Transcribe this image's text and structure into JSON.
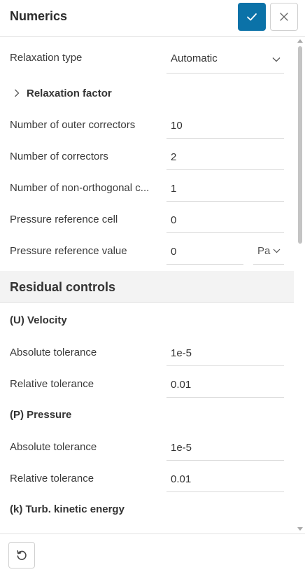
{
  "header": {
    "title": "Numerics",
    "confirm_icon": "check-icon",
    "close_icon": "close-icon"
  },
  "settings": {
    "relaxation_type": {
      "label": "Relaxation type",
      "value": "Automatic"
    },
    "relaxation_factor": {
      "label": "Relaxation factor"
    },
    "outer_correctors": {
      "label": "Number of outer correctors",
      "value": "10"
    },
    "correctors": {
      "label": "Number of correctors",
      "value": "2"
    },
    "non_orth": {
      "label": "Number of non-orthogonal c...",
      "value": "1"
    },
    "pref_cell": {
      "label": "Pressure reference cell",
      "value": "0"
    },
    "pref_value": {
      "label": "Pressure reference value",
      "value": "0",
      "unit": "Pa"
    }
  },
  "residual": {
    "title": "Residual controls",
    "velocity": {
      "title": "(U) Velocity",
      "abs_label": "Absolute tolerance",
      "abs_value": "1e-5",
      "rel_label": "Relative tolerance",
      "rel_value": "0.01"
    },
    "pressure": {
      "title": "(P) Pressure",
      "abs_label": "Absolute tolerance",
      "abs_value": "1e-5",
      "rel_label": "Relative tolerance",
      "rel_value": "0.01"
    },
    "tke": {
      "title": "(k) Turb. kinetic energy"
    }
  },
  "footer": {
    "reset_icon": "reset-icon"
  },
  "colors": {
    "accent": "#0b72a8",
    "section_band": "#f3f3f3"
  }
}
